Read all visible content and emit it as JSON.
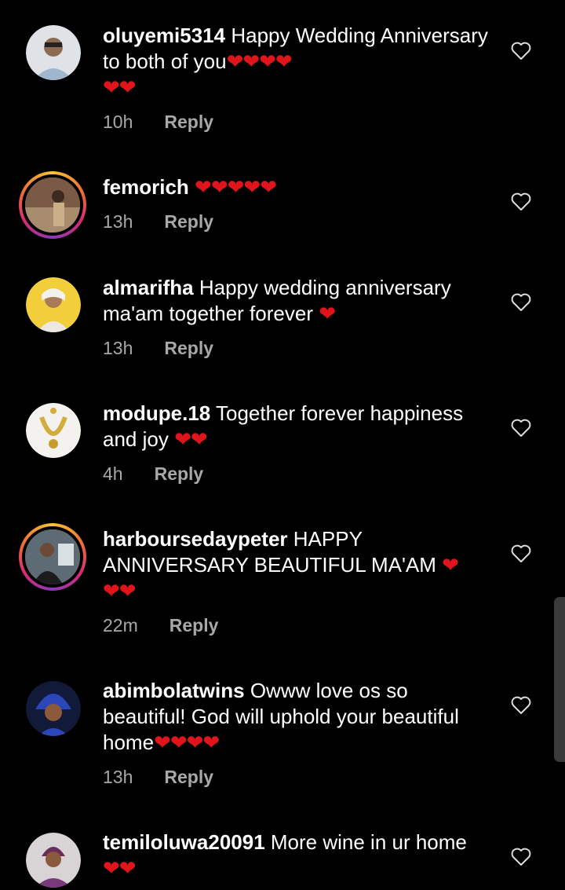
{
  "comments": [
    {
      "username": "oluyemi5314",
      "text": "Happy Wedding Anniversary to both of you",
      "hearts_inline": "❤❤❤❤",
      "hearts_next": "❤❤",
      "time": "10h",
      "reply": "Reply"
    },
    {
      "username": "femorich",
      "text": "",
      "hearts_inline": "❤❤❤❤❤",
      "time": "13h",
      "reply": "Reply"
    },
    {
      "username": "almarifha",
      "text": "Happy wedding anniversary ma'am together forever",
      "hearts_inline": "❤",
      "time": "13h",
      "reply": "Reply"
    },
    {
      "username": "modupe.18",
      "text": "Together forever happiness and joy",
      "hearts_inline": "❤❤",
      "time": "4h",
      "reply": "Reply"
    },
    {
      "username": "harboursedaypeter",
      "text": "HAPPY ANNIVERSARY BEAUTIFUL MA'AM",
      "hearts_inline": "❤",
      "hearts_next": "❤❤",
      "time": "22m",
      "reply": "Reply"
    },
    {
      "username": "abimbolatwins",
      "text": "Owww love os so beautiful! God will uphold your beautiful home",
      "hearts_inline": "❤❤❤❤",
      "time": "13h",
      "reply": "Reply"
    },
    {
      "username": "temiloluwa20091",
      "text": "More wine in ur home",
      "hearts_next": "❤❤"
    }
  ],
  "colors": {
    "heart": "#e0141b",
    "meta": "#a8a8a8",
    "background": "#000000"
  }
}
